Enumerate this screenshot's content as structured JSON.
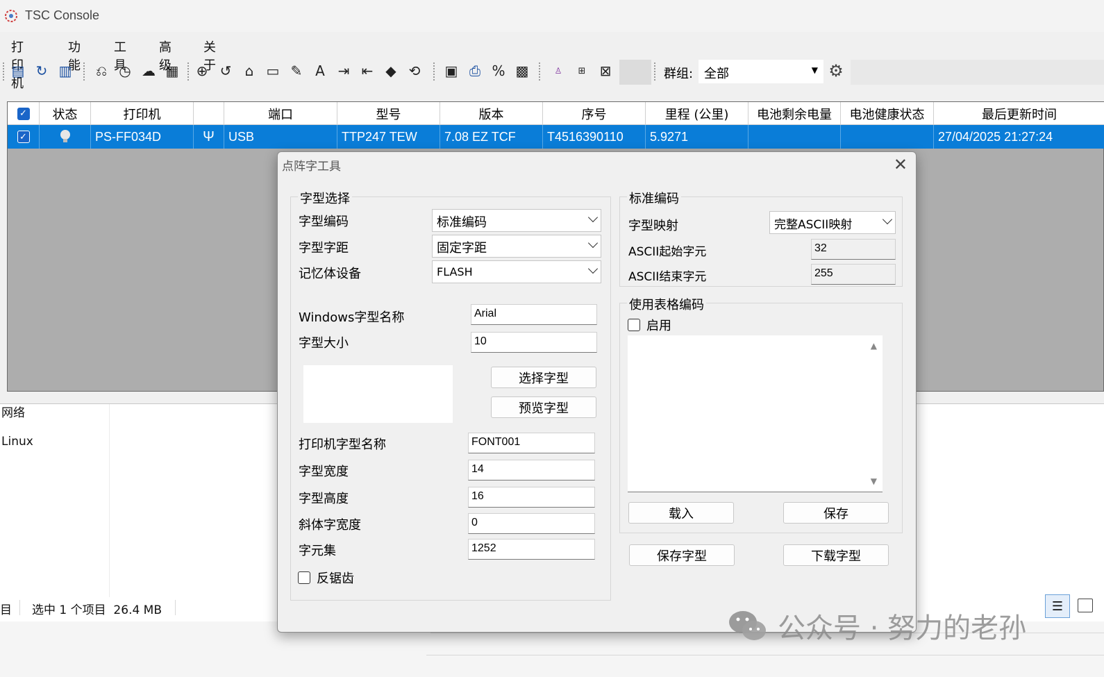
{
  "window": {
    "title": "TSC Console"
  },
  "menu": [
    "打印机",
    "功能",
    "工具",
    "高级",
    "关于"
  ],
  "toolbar": {
    "group_label": "群组:",
    "group_value": "全部"
  },
  "grid": {
    "columns": [
      "状态",
      "打印机",
      "",
      "端口",
      "型号",
      "版本",
      "序号",
      "里程 (公里)",
      "电池剩余电量",
      "电池健康状态",
      "最后更新时间"
    ],
    "rows": [
      {
        "printer": "PS-FF034D",
        "port": "USB",
        "model": "TTP247 TEW",
        "version": "7.08 EZ TCF",
        "serial": "T4516390110",
        "mileage": "5.9271",
        "battery_remaining": "",
        "battery_health": "",
        "last_update": "27/04/2025 21:27:24"
      }
    ]
  },
  "explorer": {
    "nav_items": [
      "网络",
      "Linux"
    ],
    "status_left": "目",
    "status_selected": "选中 1 个项目  26.4 MB"
  },
  "dialog": {
    "title": "点阵字工具",
    "font_select": {
      "group_label": "字型选择",
      "encoding_label": "字型编码",
      "encoding_value": "标准编码",
      "spacing_label": "字型字距",
      "spacing_value": "固定字距",
      "memory_label": "记忆体设备",
      "memory_value": "FLASH",
      "windows_font_label": "Windows字型名称",
      "windows_font_value": "Arial",
      "size_label": "字型大小",
      "size_value": "10",
      "choose_font_button": "选择字型",
      "preview_font_button": "预览字型",
      "printer_font_label": "打印机字型名称",
      "printer_font_value": "FONT001",
      "width_label": "字型宽度",
      "width_value": "14",
      "height_label": "字型高度",
      "height_value": "16",
      "italic_label": "斜体字宽度",
      "italic_value": "0",
      "charset_label": "字元集",
      "charset_value": "1252",
      "antialias_label": "反锯齿"
    },
    "standard_encoding": {
      "group_label": "标准编码",
      "mapping_label": "字型映射",
      "mapping_value": "完整ASCII映射",
      "ascii_start_label": "ASCII起始字元",
      "ascii_start_value": "32",
      "ascii_end_label": "ASCII结束字元",
      "ascii_end_value": "255"
    },
    "table_encoding": {
      "group_label": "使用表格编码",
      "enable_label": "启用",
      "load_button": "载入",
      "save_button": "保存"
    },
    "save_font_button": "保存字型",
    "download_font_button": "下载字型"
  },
  "watermark": {
    "text": "公众号 · 努力的老孙"
  },
  "colors": {
    "selection": "#0a7dd8",
    "grid_bg": "#adadad"
  }
}
